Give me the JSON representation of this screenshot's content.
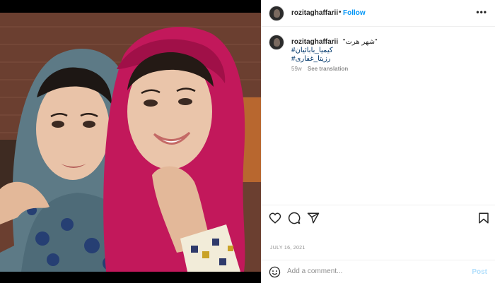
{
  "post": {
    "image_alt": "Two women in headscarves posing together for a selfie",
    "colors": {
      "follow": "#0095f6",
      "hashtag": "#00376b",
      "muted": "#8e8e8e",
      "post_button": "#b2dffc"
    }
  },
  "header": {
    "username": "rozitaghaffarii",
    "separator": "•",
    "follow_label": "Follow",
    "more_icon": "more-horizontal-icon",
    "more_label": "•••"
  },
  "caption": {
    "username": "rozitaghaffarii",
    "text": "\"شهر هرت\"",
    "hashtags": [
      "#کیمیا_بابائیان",
      "#رزیتا_غفاری"
    ],
    "age": "59w",
    "see_translation": "See translation"
  },
  "actions": {
    "icons": [
      "heart-icon",
      "comment-icon",
      "share-icon",
      "bookmark-icon"
    ]
  },
  "date": "JULY 16, 2021",
  "comment": {
    "placeholder": "Add a comment...",
    "post_label": "Post",
    "emoji_icon": "smiley-icon"
  }
}
